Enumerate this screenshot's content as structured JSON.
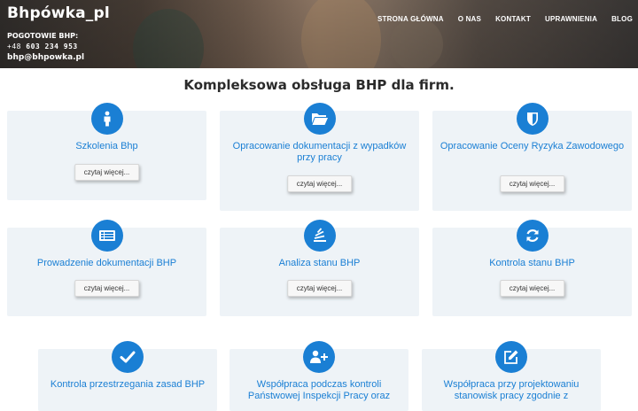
{
  "header": {
    "logo": "Bhpówka_pl",
    "emergency_label": "POGOTOWIE BHP:",
    "phone_prefix": "+48 ",
    "phone_number": "603 234 953",
    "email": "bhp@bhpowka.pl",
    "nav": [
      "STRONA GŁÓWNA",
      "O NAS",
      "KONTAKT",
      "UPRAWNIENIA",
      "BLOG"
    ]
  },
  "main": {
    "title": "Kompleksowa obsługa BHP dla firm.",
    "read_more": "czytaj więcej...",
    "cards": [
      {
        "title": "Szkolenia Bhp",
        "icon": "person-icon"
      },
      {
        "title": "Opracowanie dokumentacji z wypadków przy pracy",
        "icon": "folder-open-icon"
      },
      {
        "title": "Opracowanie Oceny Ryzyka Zawodowego",
        "icon": "shield-icon"
      },
      {
        "title": "Prowadzenie dokumentacji BHP",
        "icon": "list-document-icon"
      },
      {
        "title": "Analiza stanu BHP",
        "icon": "stack-analysis-icon"
      },
      {
        "title": "Kontrola stanu BHP",
        "icon": "refresh-icon"
      },
      {
        "title": "Kontrola przestrzegania zasad BHP",
        "icon": "check-icon"
      },
      {
        "title": "Współpraca podczas kontroli Państwowej Inspekcji Pracy oraz",
        "icon": "user-plus-icon"
      },
      {
        "title": "Współpraca przy projektowaniu stanowisk pracy zgodnie z",
        "icon": "edit-icon"
      }
    ]
  },
  "colors": {
    "accent": "#1a7fd4",
    "card_bg": "#eef3f7",
    "title_text": "#2b2b2b"
  }
}
